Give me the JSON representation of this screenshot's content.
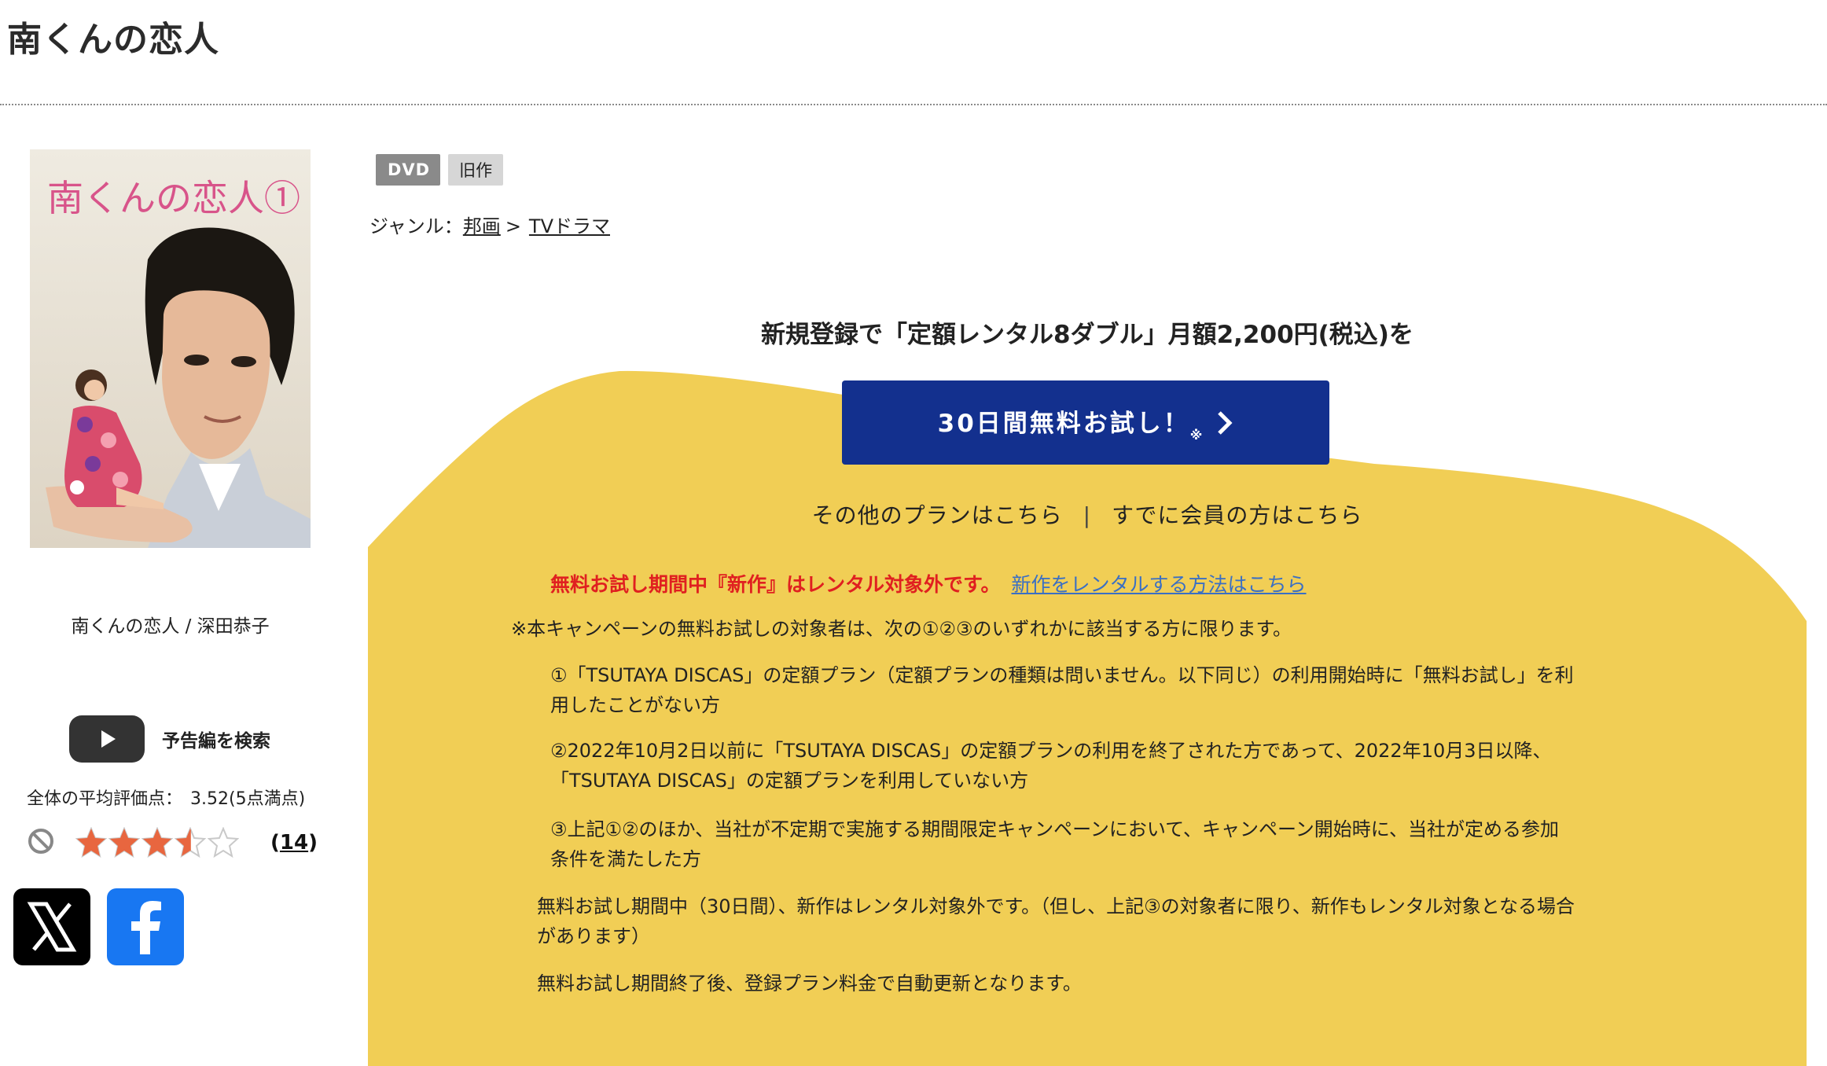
{
  "page_title": "南くんの恋人",
  "cover": {
    "title_text": "南くんの恋人①",
    "caption": "南くんの恋人 / 深田恭子"
  },
  "trailer": {
    "label": "予告編を検索"
  },
  "rating": {
    "average_label": "全体の平均評価点：",
    "average_value": "3.52(5点満点)",
    "score": 3.52,
    "max": 5,
    "review_count": "14"
  },
  "tags": [
    "DVD",
    "旧作"
  ],
  "genre": {
    "label": "ジャンル：",
    "items": [
      "邦画",
      "TVドラマ"
    ],
    "separator": ">"
  },
  "promo": {
    "headline": "新規登録で「定額レンタル8ダブル」月額2,200円(税込)を",
    "button_label": "30日間無料お試し！",
    "button_note": "※",
    "other_plans_link": "その他のプランはこちら",
    "link_divider": "|",
    "members_link": "すでに会員の方はこちら",
    "warning": "無料お試し期間中『新作』はレンタル対象外です。",
    "new_release_link": "新作をレンタルする方法はこちら",
    "conditions_intro": "※本キャンペーンの無料お試しの対象者は、次の①②③のいずれかに該当する方に限ります。",
    "condition_1_line1": "①「TSUTAYA DISCAS」の定額プラン（定額プランの種類は問いません。以下同じ）の利用開始時に「無料お試し」を利",
    "condition_1_line2": "用したことがない方",
    "condition_2_line1": "②2022年10月2日以前に「TSUTAYA DISCAS」の定額プランの利用を終了された方であって、2022年10月3日以降、",
    "condition_2_line2": "「TSUTAYA DISCAS」の定額プランを利用していない方",
    "condition_3_line1": "③上記①②のほか、当社が不定期で実施する期間限定キャンペーンにおいて、キャンペーン開始時に、当社が定める参加",
    "condition_3_line2": "条件を満たした方",
    "note_1_line1": "無料お試し期間中（30日間）、新作はレンタル対象外です。（但し、上記③の対象者に限り、新作もレンタル対象となる場合",
    "note_1_line2": "があります）",
    "note_2": "無料お試し期間終了後、登録プラン料金で自動更新となります。"
  },
  "colors": {
    "promo_yellow": "#f1ce55",
    "button_blue": "#13308e",
    "warning_red": "#e02020",
    "link_blue": "#3a6fc4",
    "star_orange": "#e8663f"
  },
  "icons": [
    "play-icon",
    "ban-icon",
    "star-icon",
    "chevron-right-icon",
    "x-logo-icon",
    "facebook-logo-icon"
  ]
}
